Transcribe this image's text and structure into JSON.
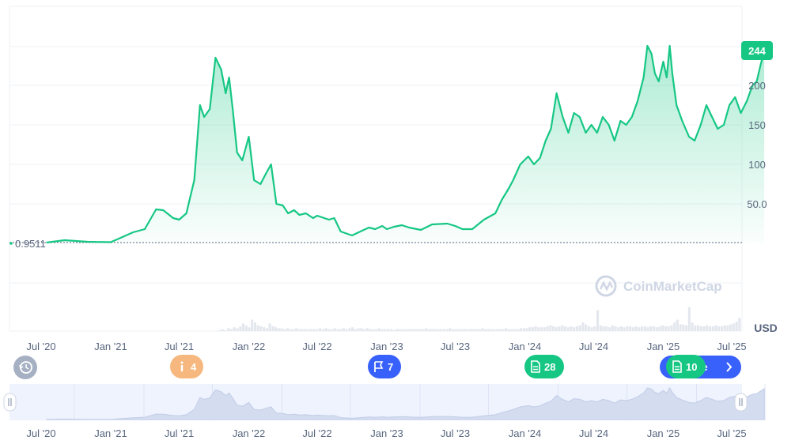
{
  "chart_data": {
    "type": "line",
    "currency_label": "USD",
    "x_ticks": [
      "Jul '20",
      "Jan '21",
      "Jul '21",
      "Jan '22",
      "Jul '22",
      "Jan '23",
      "Jul '23",
      "Jan '24",
      "Jul '24",
      "Jan '25",
      "Jul '25"
    ],
    "y_ticks": [
      "50.0",
      "100",
      "150",
      "200"
    ],
    "y_tick_values": [
      50,
      100,
      150,
      200
    ],
    "ylim": [
      -50,
      250
    ],
    "baseline_label": "0.9511",
    "baseline_value": 0.9511,
    "last_price_label": "244",
    "last_price_value": 244,
    "series": [
      {
        "x": [
          "2020-07-15",
          "2020-09-01",
          "2020-11-01",
          "2021-01-01",
          "2021-02-01",
          "2021-03-01",
          "2021-04-01",
          "2021-05-01",
          "2021-05-20",
          "2021-06-15",
          "2021-07-01",
          "2021-07-20",
          "2021-08-10",
          "2021-08-25",
          "2021-09-05",
          "2021-09-20",
          "2021-10-05",
          "2021-10-20",
          "2021-11-01",
          "2021-11-10",
          "2021-11-20",
          "2021-12-01",
          "2021-12-15",
          "2022-01-01",
          "2022-01-15",
          "2022-02-01",
          "2022-02-15",
          "2022-03-01",
          "2022-03-15",
          "2022-04-01",
          "2022-04-15",
          "2022-05-01",
          "2022-05-15",
          "2022-06-01",
          "2022-06-20",
          "2022-07-01",
          "2022-08-01",
          "2022-08-15",
          "2022-09-01",
          "2022-10-01",
          "2022-11-01",
          "2022-11-15",
          "2022-12-01",
          "2022-12-20",
          "2023-01-01",
          "2023-01-20",
          "2023-02-10",
          "2023-03-01",
          "2023-04-01",
          "2023-05-01",
          "2023-06-10",
          "2023-07-01",
          "2023-07-20",
          "2023-08-15",
          "2023-09-15",
          "2023-10-15",
          "2023-11-01",
          "2023-11-20",
          "2023-12-01",
          "2023-12-20",
          "2024-01-10",
          "2024-01-25",
          "2024-02-10",
          "2024-02-25",
          "2024-03-10",
          "2024-03-25",
          "2024-04-10",
          "2024-04-25",
          "2024-05-10",
          "2024-05-25",
          "2024-06-10",
          "2024-06-25",
          "2024-07-10",
          "2024-07-25",
          "2024-08-10",
          "2024-08-25",
          "2024-09-10",
          "2024-09-25",
          "2024-10-10",
          "2024-10-25",
          "2024-11-10",
          "2024-11-20",
          "2024-12-01",
          "2024-12-10",
          "2024-12-20",
          "2025-01-01",
          "2025-01-10",
          "2025-01-18",
          "2025-01-25",
          "2025-02-05",
          "2025-02-20",
          "2025-03-10",
          "2025-03-25",
          "2025-04-10",
          "2025-04-25",
          "2025-05-10",
          "2025-05-25",
          "2025-06-10",
          "2025-06-25",
          "2025-07-10",
          "2025-07-25",
          "2025-08-10",
          "2025-08-25",
          "2025-09-05",
          "2025-09-15",
          "2025-09-25"
        ],
        "y": [
          1,
          4,
          2,
          1.5,
          8,
          14,
          18,
          43,
          42,
          32,
          30,
          38,
          80,
          175,
          160,
          170,
          235,
          220,
          190,
          210,
          168,
          115,
          105,
          135,
          80,
          75,
          88,
          100,
          50,
          48,
          38,
          42,
          36,
          38,
          32,
          35,
          30,
          32,
          15,
          10,
          17,
          20,
          18,
          22,
          18,
          21,
          23,
          20,
          17,
          24,
          25,
          22,
          18,
          18,
          30,
          38,
          55,
          70,
          80,
          100,
          110,
          100,
          108,
          130,
          145,
          190,
          160,
          140,
          165,
          160,
          140,
          150,
          140,
          160,
          150,
          130,
          155,
          150,
          160,
          180,
          210,
          250,
          240,
          215,
          205,
          230,
          210,
          250,
          215,
          175,
          155,
          135,
          130,
          150,
          175,
          160,
          145,
          150,
          175,
          185,
          165,
          180,
          200,
          205,
          225,
          244
        ]
      }
    ],
    "volume": [
      0,
      0,
      0,
      0,
      0,
      0,
      0,
      0,
      0,
      0,
      0,
      0,
      0,
      0,
      0,
      0,
      0,
      0,
      0,
      0,
      0,
      0,
      0,
      0,
      0,
      0,
      0,
      0,
      0,
      0,
      0,
      0,
      0,
      0,
      0,
      0,
      0,
      0,
      0,
      0,
      0,
      0,
      0,
      0,
      0,
      0,
      0,
      0,
      0,
      0,
      0,
      0,
      0,
      0,
      0,
      0,
      0,
      0,
      0,
      0,
      1,
      2,
      1,
      3,
      2,
      4,
      3,
      5,
      8,
      6,
      4,
      12,
      9,
      6,
      5,
      4,
      3,
      8,
      5,
      4,
      3,
      3,
      2,
      3,
      2,
      2,
      3,
      2,
      2,
      2,
      2,
      2,
      2,
      2,
      3,
      2,
      3,
      2,
      2,
      3,
      2,
      2,
      3,
      2,
      3,
      4,
      2,
      3,
      3,
      2,
      3,
      2,
      2,
      2,
      3,
      2,
      2,
      2,
      2,
      1,
      2,
      2,
      2,
      2,
      2,
      2,
      2,
      2,
      2,
      2,
      3,
      2,
      2,
      2,
      2,
      2,
      2,
      2,
      3,
      2,
      2,
      2,
      2,
      2,
      2,
      2,
      2,
      2,
      2,
      3,
      2,
      2,
      2,
      2,
      2,
      2,
      2,
      3,
      2,
      2,
      2,
      2,
      3,
      3,
      3,
      4,
      4,
      5,
      4,
      4,
      4,
      5,
      6,
      5,
      4,
      5,
      6,
      5,
      4,
      5,
      4,
      5,
      6,
      9,
      7,
      5,
      4,
      5,
      22,
      6,
      5,
      5,
      4,
      6,
      5,
      4,
      5,
      4,
      5,
      5,
      4,
      5,
      4,
      5,
      5,
      4,
      5,
      5,
      4,
      5,
      6,
      5,
      5,
      6,
      9,
      12,
      7,
      7,
      6,
      25,
      9,
      6,
      6,
      5,
      5,
      6,
      5,
      5,
      6,
      5,
      5,
      6,
      6,
      7,
      8,
      10,
      14
    ]
  },
  "events": [
    {
      "icon": "info-icon",
      "count": "4",
      "color": "#f6b87e"
    },
    {
      "icon": "flag-icon",
      "count": "7",
      "color": "#3861fb"
    },
    {
      "icon": "document-icon",
      "count": "28",
      "color": "#16c784"
    },
    {
      "icon": "document-icon",
      "count": "10",
      "color": "#16c784"
    }
  ],
  "analyze_button": {
    "label": "lyze"
  },
  "watermark": {
    "brand": "CoinMarketCap"
  },
  "colors": {
    "line": "#16c784",
    "grid": "#eff2f5",
    "navigator_fill": "#dbe4f8",
    "navigator_bg": "#eef3fe",
    "history_button": "#a6b0c3",
    "analyze": "#3861fb"
  }
}
